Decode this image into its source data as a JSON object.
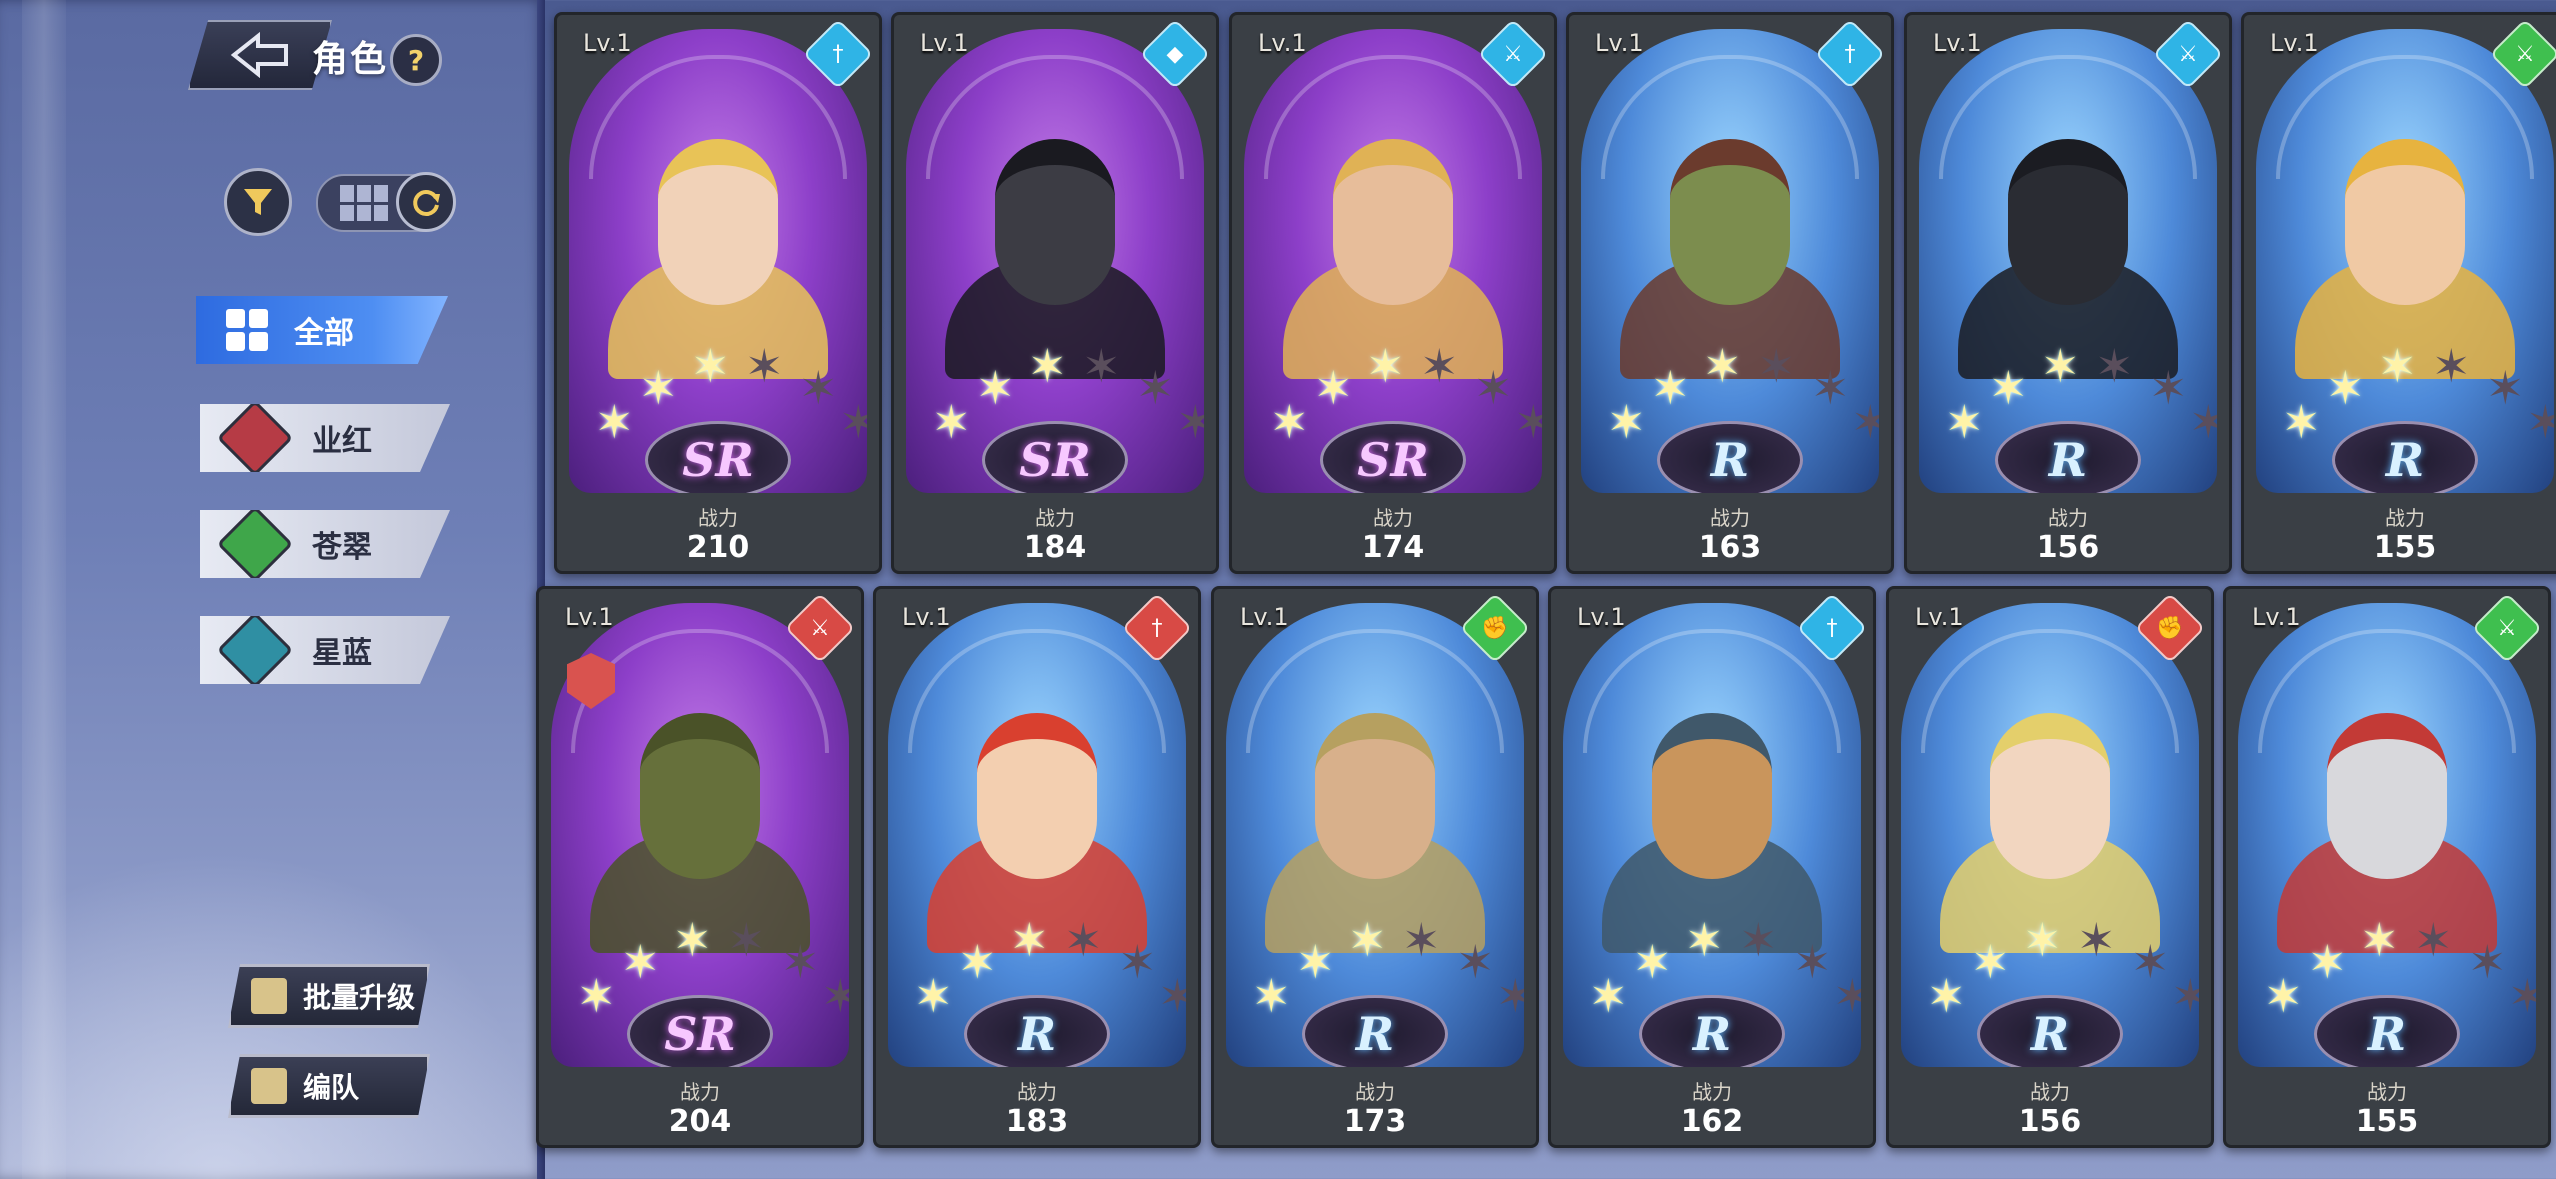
{
  "header": {
    "title": "角色",
    "help_label": "?"
  },
  "categories": [
    {
      "label": "全部",
      "active": true,
      "color": "#3a7ae8"
    },
    {
      "label": "业红",
      "active": false,
      "color": "#b63b45"
    },
    {
      "label": "苍翠",
      "active": false,
      "color": "#3fa64a"
    },
    {
      "label": "星蓝",
      "active": false,
      "color": "#2f8fa3"
    }
  ],
  "buttons": {
    "batch_upgrade": "批量升级",
    "team": "编队"
  },
  "power_label": "战力",
  "cards": [
    {
      "level": "Lv.1",
      "rarity": "SR",
      "power": "210",
      "stars": 3,
      "role_icon": "dagger-icon",
      "role_color": "#2fb4e6",
      "skin": "#f1d2b8",
      "hair": "#e8c357"
    },
    {
      "level": "Lv.1",
      "rarity": "SR",
      "power": "184",
      "stars": 3,
      "role_icon": "shield-icon",
      "role_color": "#2fb4e6",
      "skin": "#3c3c44",
      "hair": "#1a1a20"
    },
    {
      "level": "Lv.1",
      "rarity": "SR",
      "power": "174",
      "stars": 3,
      "role_icon": "sword-icon",
      "role_color": "#2fb4e6",
      "skin": "#e7bd9a",
      "hair": "#e0b255"
    },
    {
      "level": "Lv.1",
      "rarity": "R",
      "power": "163",
      "stars": 3,
      "role_icon": "dagger-icon",
      "role_color": "#2fb4e6",
      "skin": "#7c8d4e",
      "hair": "#6b3b2d"
    },
    {
      "level": "Lv.1",
      "rarity": "R",
      "power": "156",
      "stars": 3,
      "role_icon": "sword-icon",
      "role_color": "#2fb4e6",
      "skin": "#2a2c33",
      "hair": "#1b1c22"
    },
    {
      "level": "Lv.1",
      "rarity": "R",
      "power": "155",
      "stars": 3,
      "role_icon": "sword-icon",
      "role_color": "#3fbf4f",
      "skin": "#f0c9a4",
      "hair": "#e7b33f"
    },
    {
      "level": "Lv.1",
      "rarity": "SR",
      "power": "204",
      "stars": 3,
      "role_icon": "sword-icon",
      "role_color": "#d84a45",
      "skin": "#66703b",
      "hair": "#4a5228",
      "emblem": true
    },
    {
      "level": "Lv.1",
      "rarity": "R",
      "power": "183",
      "stars": 3,
      "role_icon": "dagger-icon",
      "role_color": "#d84a45",
      "skin": "#f3cfb0",
      "hair": "#d9402f"
    },
    {
      "level": "Lv.1",
      "rarity": "R",
      "power": "173",
      "stars": 3,
      "role_icon": "fist-icon",
      "role_color": "#3fbf4f",
      "skin": "#d8b08b",
      "hair": "#b6a060"
    },
    {
      "level": "Lv.1",
      "rarity": "R",
      "power": "162",
      "stars": 3,
      "role_icon": "dagger-icon",
      "role_color": "#2fb4e6",
      "skin": "#c9955c",
      "hair": "#40586a"
    },
    {
      "level": "Lv.1",
      "rarity": "R",
      "power": "156",
      "stars": 3,
      "role_icon": "fist-icon",
      "role_color": "#d84a45",
      "skin": "#f2d6c0",
      "hair": "#e4cf6b"
    },
    {
      "level": "Lv.1",
      "rarity": "R",
      "power": "155",
      "stars": 3,
      "role_icon": "sword-icon",
      "role_color": "#3fbf4f",
      "skin": "#d8d8dc",
      "hair": "#c33a36"
    }
  ]
}
